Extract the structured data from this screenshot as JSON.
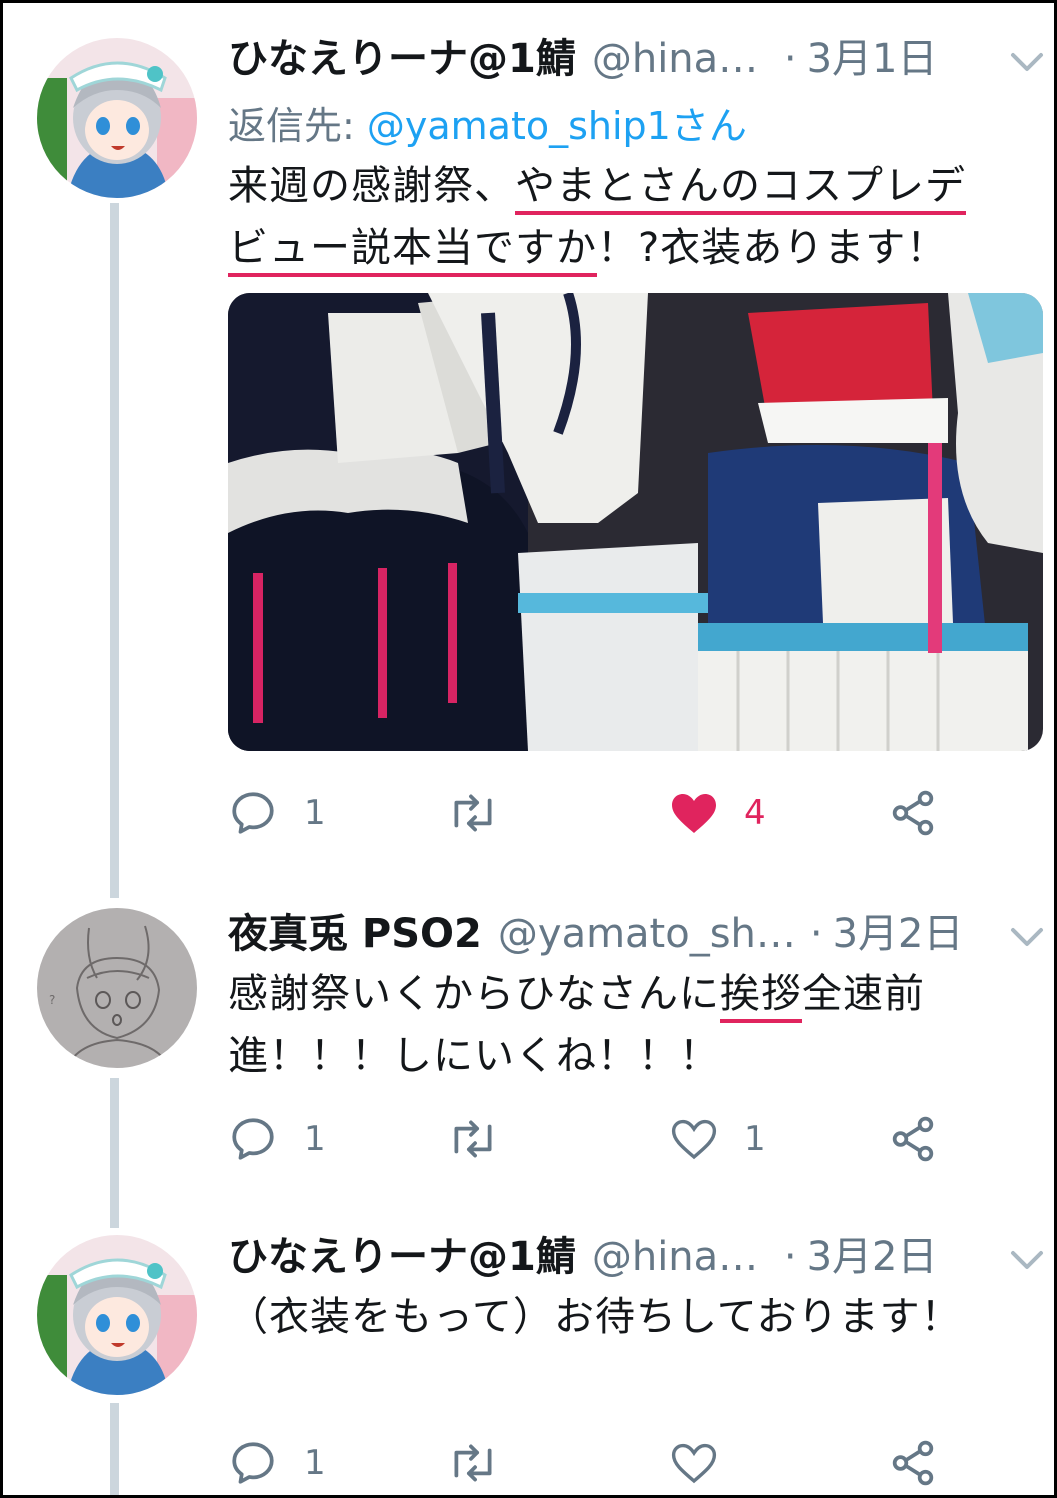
{
  "tweets": [
    {
      "name": "ひなえりーナ@1鯖",
      "handle": "@hinae...",
      "sep": "·",
      "date": "3月1日",
      "reply_label": "返信先: ",
      "reply_mention": "@yamato_ship1さん",
      "text_line1_a": "来週の感謝祭、",
      "text_line1_b": "やまとさんのコスプレデ",
      "text_line2_a": "ビュー説本当ですか",
      "text_line2_b": "！?衣装あります！",
      "reply_count": "1",
      "retweet_count": "",
      "like_count": "4",
      "liked": true,
      "avatar_icon": "anime-girl-avatar",
      "photo_desc_icon": "costume-photo"
    },
    {
      "name": "夜真兎 PSO2",
      "handle": "@yamato_shi...",
      "sep": "·",
      "date": "3月2日",
      "text_line1_a": "感謝祭いくからひなさんに",
      "text_line1_b": "挨拶",
      "text_line1_c": "全速前",
      "text_line2_a": "進！！！しにいくね！！！",
      "reply_count": "1",
      "retweet_count": "",
      "like_count": "1",
      "liked": false,
      "avatar_icon": "sketch-avatar"
    },
    {
      "name": "ひなえりーナ@1鯖",
      "handle": "@hinae...",
      "sep": "·",
      "date": "3月2日",
      "text_line1_a": "（衣装をもって）お待ちしております！",
      "reply_count": "1",
      "retweet_count": "",
      "like_count": "",
      "liked": false,
      "avatar_icon": "anime-girl-avatar"
    }
  ],
  "colors": {
    "like_red": "#e0245e",
    "mention_blue": "#1da1f2",
    "muted": "#657786",
    "thread_line": "#ccd6dd"
  }
}
